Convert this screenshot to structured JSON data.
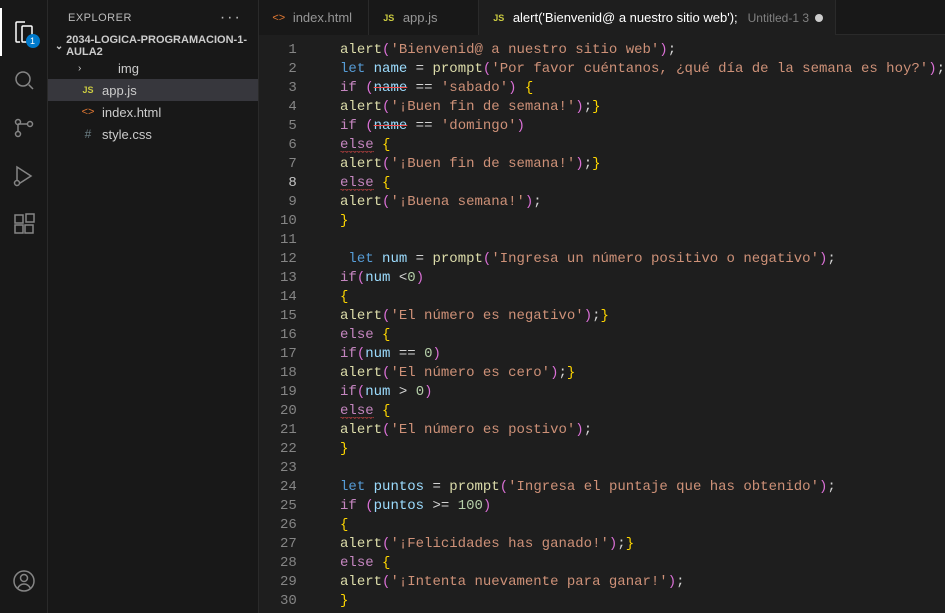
{
  "activityBar": {
    "explorerBadge": "1"
  },
  "sidebar": {
    "title": "Explorer",
    "actions": "···",
    "folderName": "2034-LOGICA-PROGRAMACION-1-AULA2",
    "items": [
      {
        "name": "img",
        "type": "folder"
      },
      {
        "name": "app.js",
        "type": "js",
        "selected": true
      },
      {
        "name": "index.html",
        "type": "html"
      },
      {
        "name": "style.css",
        "type": "css"
      }
    ]
  },
  "tabs": [
    {
      "icon": "html",
      "label": "index.html",
      "active": false,
      "dirty": false
    },
    {
      "icon": "js",
      "label": "app.js",
      "active": false,
      "dirty": false
    },
    {
      "icon": "js",
      "label": "alert('Bienvenid@ a nuestro sitio web');",
      "secondary": "Untitled-1 3",
      "active": true,
      "dirty": true
    }
  ],
  "editor": {
    "currentLine": 8,
    "lines": [
      "   alert('Bienvenid@ a nuestro sitio web');",
      "   let name = prompt('Por favor cuéntanos, ¿qué día de la semana es hoy?');",
      "   if (name == 'sabado') {",
      "   alert('¡Buen fin de semana!');}",
      "   if (name == 'domingo')",
      "   else {",
      "   alert('¡Buen fin de semana!');}",
      "   else {",
      "   alert('¡Buena semana!');",
      "   }",
      "",
      "    let num = prompt('Ingresa un número positivo o negativo');",
      "   if(num <0)",
      "   {",
      "   alert('El número es negativo');}",
      "   else {",
      "   if(num == 0)",
      "   alert('El número es cero');}",
      "   if(num > 0)",
      "   else {",
      "   alert('El número es postivo');",
      "   }",
      "",
      "   let puntos = prompt('Ingresa el puntaje que has obtenido');",
      "   if (puntos >= 100)",
      "   {",
      "   alert('¡Felicidades has ganado!');}",
      "   else {",
      "   alert('¡Intenta nuevamente para ganar!');",
      "   }"
    ]
  }
}
